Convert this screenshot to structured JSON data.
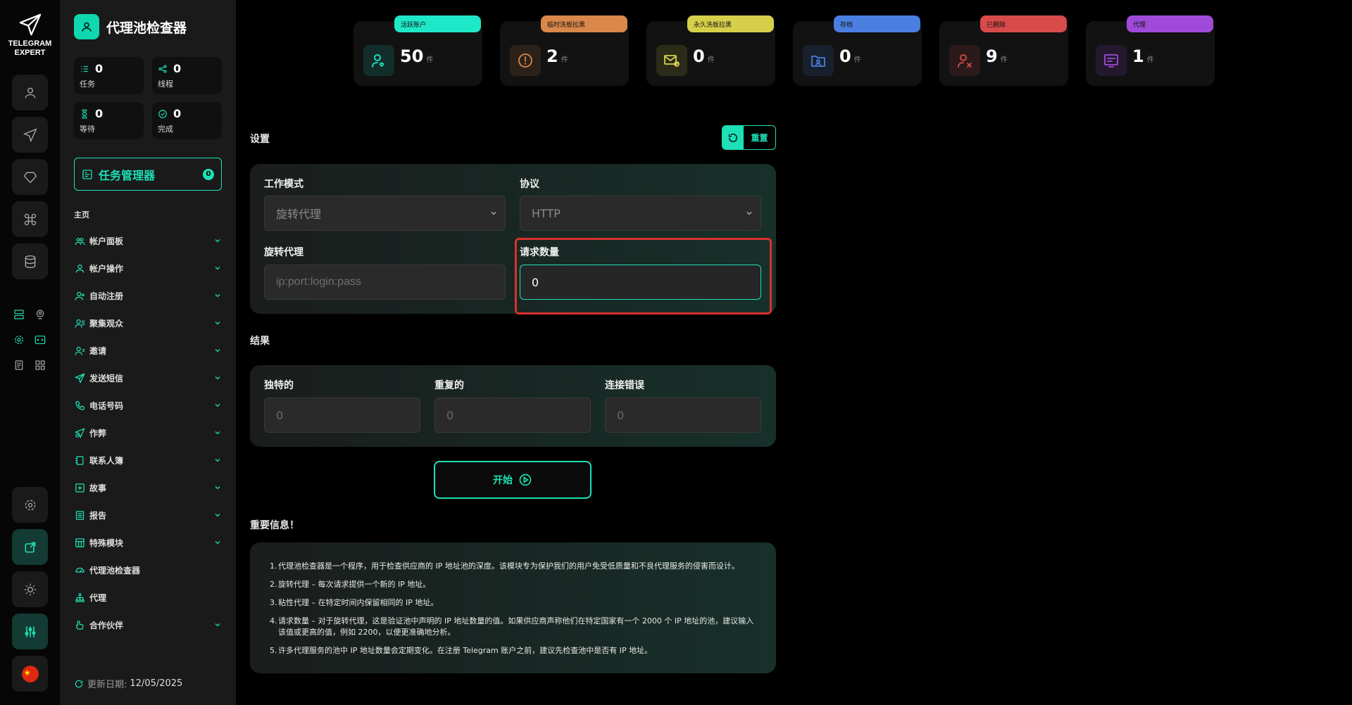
{
  "brand": {
    "line1": "TELEGRAM",
    "line2": "EXPERT"
  },
  "sidebar": {
    "title": "代理池检查器",
    "stats": [
      {
        "value": "0",
        "label": "任务",
        "icon": "list-icon"
      },
      {
        "value": "0",
        "label": "线程",
        "icon": "share-icon"
      },
      {
        "value": "0",
        "label": "等待",
        "icon": "hourglass-icon"
      },
      {
        "value": "0",
        "label": "完成",
        "icon": "check-circle-icon"
      }
    ],
    "task_manager": {
      "label": "任务管理器",
      "badge": "0"
    },
    "menu_heading": "主页",
    "items": [
      {
        "label": "帐户面板",
        "icon": "users-icon",
        "chevron": true
      },
      {
        "label": "帐户操作",
        "icon": "user-icon",
        "chevron": true
      },
      {
        "label": "自动注册",
        "icon": "user-plus-icon",
        "chevron": true
      },
      {
        "label": "聚集观众",
        "icon": "audience-icon",
        "chevron": true
      },
      {
        "label": "邀请",
        "icon": "invite-icon",
        "chevron": true
      },
      {
        "label": "发送短信",
        "icon": "send-icon",
        "chevron": true
      },
      {
        "label": "电话号码",
        "icon": "phone-icon",
        "chevron": true
      },
      {
        "label": "作弊",
        "icon": "boost-icon",
        "chevron": true
      },
      {
        "label": "联系人簿",
        "icon": "contacts-icon",
        "chevron": true
      },
      {
        "label": "故事",
        "icon": "story-icon",
        "chevron": true
      },
      {
        "label": "报告",
        "icon": "report-icon",
        "chevron": true
      },
      {
        "label": "特殊模块",
        "icon": "module-icon",
        "chevron": true
      },
      {
        "label": "代理池检查器",
        "icon": "gauge-icon",
        "chevron": false
      },
      {
        "label": "代理",
        "icon": "network-icon",
        "chevron": false
      },
      {
        "label": "合作伙伴",
        "icon": "partner-icon",
        "chevron": true
      }
    ],
    "update_label": "更新日期:",
    "update_date": "12/05/2025"
  },
  "tiles": [
    {
      "tag": "活跃账户",
      "value": "50",
      "unit": "件",
      "color": "#1ee8c8",
      "icon": "user-heart-icon"
    },
    {
      "tag": "临时洗板拉黑",
      "value": "2",
      "unit": "件",
      "color": "#d9874a",
      "icon": "warning-icon"
    },
    {
      "tag": "永久洗板拉黑",
      "value": "0",
      "unit": "件",
      "color": "#d6cf4a",
      "icon": "mail-block-icon"
    },
    {
      "tag": "存档",
      "value": "0",
      "unit": "件",
      "color": "#4a7ee0",
      "icon": "archive-folder-icon"
    },
    {
      "tag": "已删除",
      "value": "9",
      "unit": "件",
      "color": "#d94a4a",
      "icon": "user-x-icon"
    },
    {
      "tag": "代理",
      "value": "1",
      "unit": "件",
      "color": "#a04ad9",
      "icon": "proxy-icon"
    }
  ],
  "settings": {
    "heading": "设置",
    "reset_label": "重置",
    "work_mode_label": "工作模式",
    "work_mode_value": "旋转代理",
    "protocol_label": "协议",
    "protocol_value": "HTTP",
    "rotating_label": "旋转代理",
    "rotating_placeholder": "ip:port:login:pass",
    "request_count_label": "请求数量",
    "request_count_value": "0"
  },
  "results": {
    "heading": "结果",
    "unique_label": "独特的",
    "unique_value": "0",
    "duplicate_label": "重复的",
    "duplicate_value": "0",
    "error_label": "连接错误",
    "error_value": "0"
  },
  "start_label": "开始",
  "info": {
    "heading": "重要信息！",
    "items": [
      "代理池检查器是一个程序，用于检查供应商的 IP 地址池的深度。该模块专为保护我们的用户免受低质量和不良代理服务的侵害而设计。",
      "旋转代理 – 每次请求提供一个新的 IP 地址。",
      "粘性代理 – 在特定时间内保留相同的 IP 地址。",
      "请求数量 – 对于旋转代理，这是验证池中声明的 IP 地址数量的值。如果供应商声称他们在特定国家有一个 2000 个 IP 地址的池，建议输入该值或更高的值，例如 2200，以便更准确地分析。",
      "许多代理服务的池中 IP 地址数量会定期变化。在注册 Telegram 账户之前，建议先检查池中是否有 IP 地址。"
    ]
  }
}
